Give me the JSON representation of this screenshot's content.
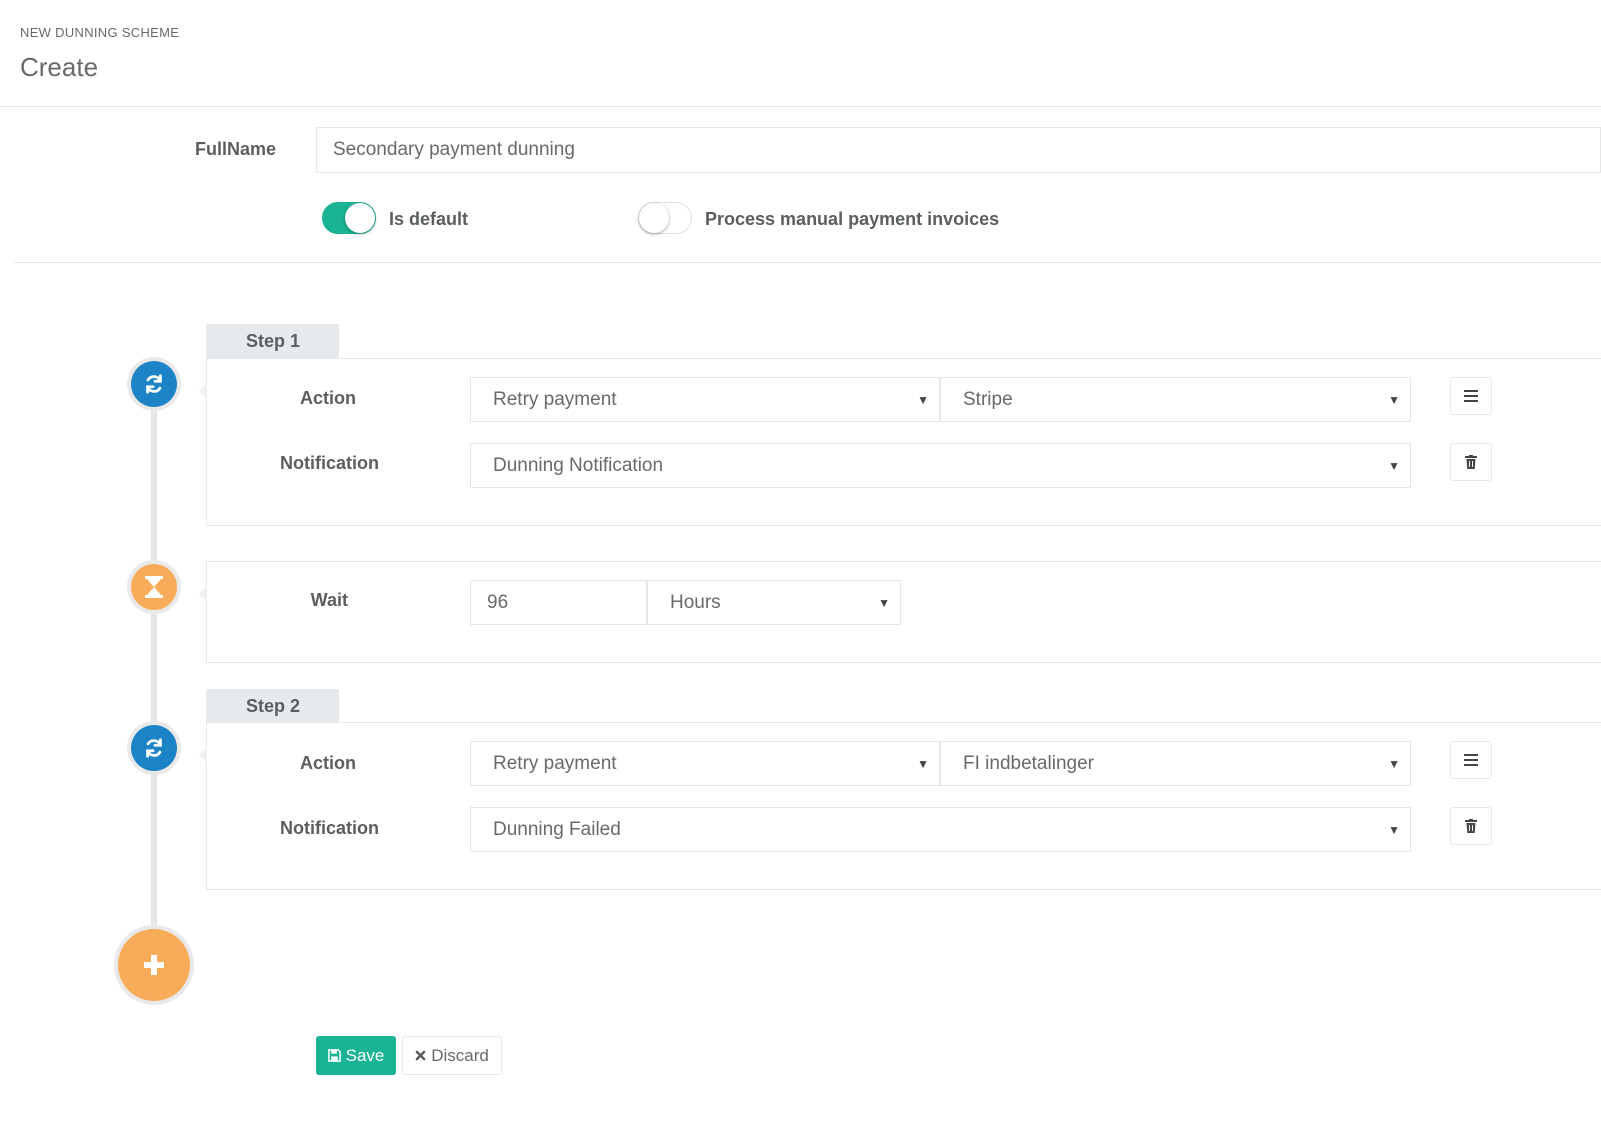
{
  "header": {
    "kicker": "NEW DUNNING SCHEME",
    "title": "Create"
  },
  "form": {
    "fullname_label": "FullName",
    "fullname_value": "Secondary payment dunning",
    "toggles": [
      {
        "label": "Is default",
        "on": true
      },
      {
        "label": "Process manual payment invoices",
        "on": false
      }
    ]
  },
  "steps": [
    {
      "tab": "Step 1",
      "action_label": "Action",
      "action_value": "Retry payment",
      "gateway_value": "Stripe",
      "notification_label": "Notification",
      "notification_value": "Dunning Notification"
    },
    {
      "tab": "Step 2",
      "action_label": "Action",
      "action_value": "Retry payment",
      "gateway_value": "FI indbetalinger",
      "notification_label": "Notification",
      "notification_value": "Dunning Failed"
    }
  ],
  "wait": {
    "label": "Wait",
    "amount": "96",
    "unit": "Hours"
  },
  "buttons": {
    "save": "Save",
    "discard": "Discard"
  },
  "colors": {
    "primary": "#1ab394",
    "timeline_blue": "#1c84c6",
    "timeline_orange": "#f8ac59"
  },
  "icons": {
    "step": "refresh-icon",
    "wait": "hourglass-icon",
    "add": "plus-icon",
    "reorder": "menu-icon",
    "delete": "trash-icon",
    "save": "floppy-icon",
    "discard": "close-icon"
  }
}
